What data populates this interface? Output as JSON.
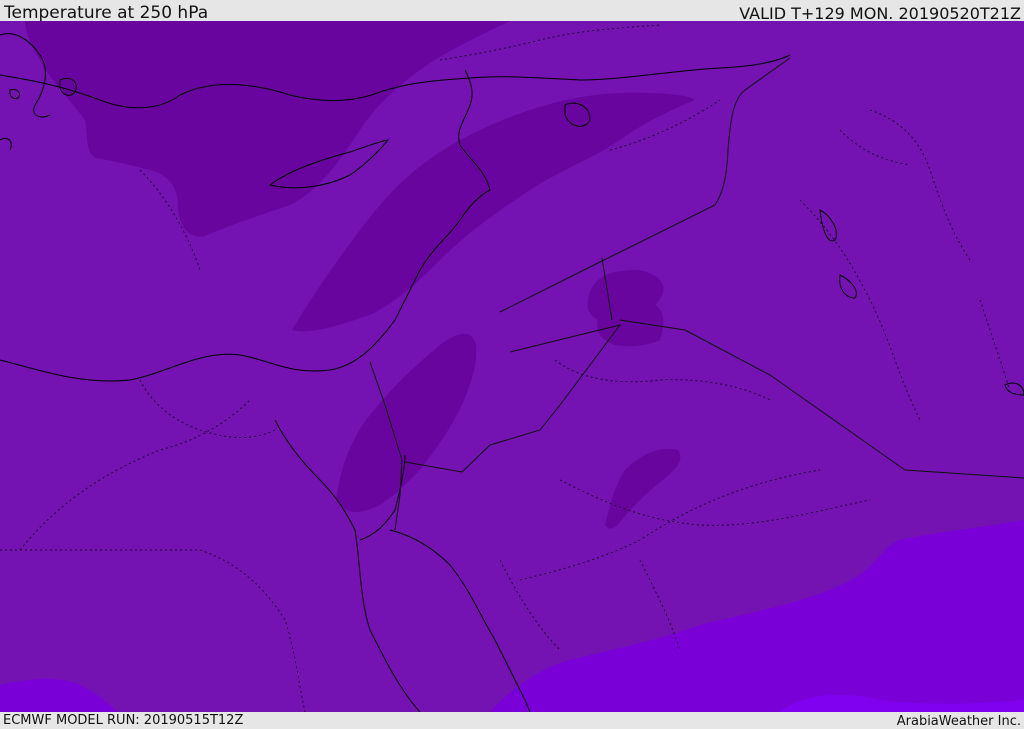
{
  "header": {
    "title": "Temperature at 250 hPa",
    "valid": "VALID T+129 MON. 20190520T21Z"
  },
  "footer": {
    "model_run": "ECMWF MODEL RUN: 20190515T12Z",
    "credit": "ArabiaWeather Inc."
  },
  "colors": {
    "background_frame": "#e6e6e6",
    "base_field": "#7412b2",
    "cold_band": "#68059e",
    "warm_band": "#7a00d8",
    "warmer_band": "#8000f0",
    "coastline": "#000000",
    "borders": "#1a0030"
  }
}
